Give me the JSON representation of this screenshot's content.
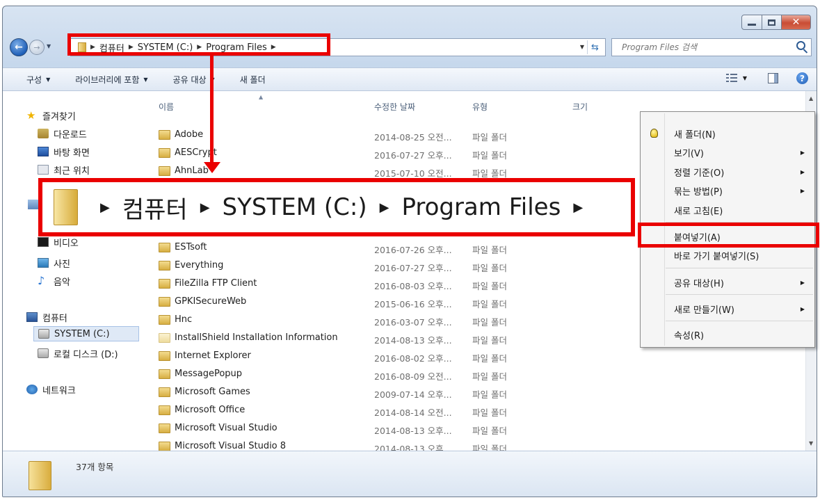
{
  "address": {
    "crumbs": [
      "컴퓨터",
      "SYSTEM (C:)",
      "Program Files"
    ],
    "search_placeholder": "Program Files 검색"
  },
  "toolbar": {
    "organize": "구성",
    "include_library": "라이브러리에 포함",
    "share_with": "공유 대상",
    "new_folder": "새 폴더"
  },
  "nav": {
    "favorites": "즐겨찾기",
    "downloads": "다운로드",
    "desktop": "바탕 화면",
    "recent": "최근 위치",
    "video": "비디오",
    "photos": "사진",
    "music": "음악",
    "computer": "컴퓨터",
    "system_c": "SYSTEM (C:)",
    "local_d": "로컬 디스크 (D:)",
    "network": "네트워크"
  },
  "columns": {
    "name": "이름",
    "date": "수정한 날짜",
    "type": "유형",
    "size": "크기"
  },
  "files": [
    {
      "name": "Adobe",
      "date": "2014-08-25 오전...",
      "type": "파일 폴더"
    },
    {
      "name": "AESCrypt",
      "date": "2016-07-27 오후...",
      "type": "파일 폴더"
    },
    {
      "name": "AhnLab",
      "date": "2015-07-10 오전...",
      "type": "파일 폴더"
    },
    {
      "name": "ESTsoft",
      "date": "2016-07-26 오후...",
      "type": "파일 폴더"
    },
    {
      "name": "Everything",
      "date": "2016-07-27 오후...",
      "type": "파일 폴더"
    },
    {
      "name": "FileZilla FTP Client",
      "date": "2016-08-03 오후...",
      "type": "파일 폴더"
    },
    {
      "name": "GPKISecureWeb",
      "date": "2015-06-16 오후...",
      "type": "파일 폴더"
    },
    {
      "name": "Hnc",
      "date": "2016-03-07 오후...",
      "type": "파일 폴더"
    },
    {
      "name": "InstallShield Installation Information",
      "date": "2014-08-13 오후...",
      "type": "파일 폴더"
    },
    {
      "name": "Internet Explorer",
      "date": "2016-08-02 오후...",
      "type": "파일 폴더"
    },
    {
      "name": "MessagePopup",
      "date": "2016-08-09 오전...",
      "type": "파일 폴더"
    },
    {
      "name": "Microsoft Games",
      "date": "2009-07-14 오후...",
      "type": "파일 폴더"
    },
    {
      "name": "Microsoft Office",
      "date": "2014-08-14 오전...",
      "type": "파일 폴더"
    },
    {
      "name": "Microsoft Visual Studio",
      "date": "2014-08-13 오후...",
      "type": "파일 폴더"
    },
    {
      "name": "Microsoft Visual Studio 8",
      "date": "2014-08-13 오후...",
      "type": "파일 폴더"
    }
  ],
  "status": {
    "count": "37개 항목"
  },
  "context_menu": {
    "new_folder": "새 폴더(N)",
    "view": "보기(V)",
    "sort_by": "정렬 기준(O)",
    "group_by": "묶는 방법(P)",
    "refresh": "새로 고침(E)",
    "paste": "붙여넣기(A)",
    "paste_shortcut": "바로 가기 붙여넣기(S)",
    "share_with": "공유 대상(H)",
    "new": "새로 만들기(W)",
    "properties": "속성(R)"
  },
  "colors": {
    "highlight_red": "#ea0000",
    "selection_blue": "#dfe9f6"
  }
}
